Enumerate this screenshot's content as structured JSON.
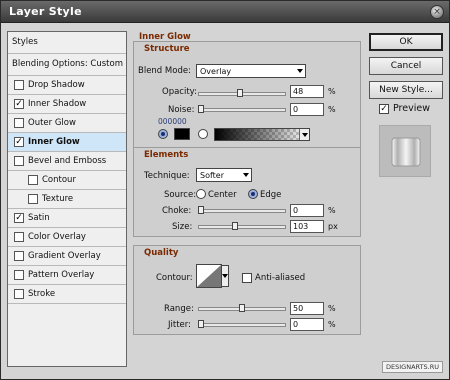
{
  "window": {
    "title": "Layer Style"
  },
  "sidebar": {
    "styles_label": "Styles",
    "blending_label": "Blending Options: Custom",
    "items": [
      {
        "label": "Drop Shadow",
        "checked": false
      },
      {
        "label": "Inner Shadow",
        "checked": true
      },
      {
        "label": "Outer Glow",
        "checked": false
      },
      {
        "label": "Inner Glow",
        "checked": true,
        "selected": true
      },
      {
        "label": "Bevel and Emboss",
        "checked": false
      },
      {
        "label": "Contour",
        "checked": false,
        "sub": true
      },
      {
        "label": "Texture",
        "checked": false,
        "sub": true
      },
      {
        "label": "Satin",
        "checked": true
      },
      {
        "label": "Color Overlay",
        "checked": false
      },
      {
        "label": "Gradient Overlay",
        "checked": false
      },
      {
        "label": "Pattern Overlay",
        "checked": false
      },
      {
        "label": "Stroke",
        "checked": false
      }
    ]
  },
  "panel": {
    "title": "Inner Glow",
    "structure": {
      "heading": "Structure",
      "blend_mode_label": "Blend Mode:",
      "blend_mode_value": "Overlay",
      "opacity_label": "Opacity:",
      "opacity_value": "48",
      "opacity_unit": "%",
      "noise_label": "Noise:",
      "noise_value": "0",
      "noise_unit": "%",
      "color_hex": "000000"
    },
    "elements": {
      "heading": "Elements",
      "technique_label": "Technique:",
      "technique_value": "Softer",
      "source_label": "Source:",
      "source_center": "Center",
      "source_edge": "Edge",
      "choke_label": "Choke:",
      "choke_value": "0",
      "choke_unit": "%",
      "size_label": "Size:",
      "size_value": "103",
      "size_unit": "px"
    },
    "quality": {
      "heading": "Quality",
      "contour_label": "Contour:",
      "antialiased_label": "Anti-aliased",
      "range_label": "Range:",
      "range_value": "50",
      "range_unit": "%",
      "jitter_label": "Jitter:",
      "jitter_value": "0",
      "jitter_unit": "%"
    }
  },
  "buttons": {
    "ok": "OK",
    "cancel": "Cancel",
    "new_style": "New Style...",
    "preview_label": "Preview"
  },
  "footer": {
    "credit": "DESIGNARTS.RU"
  }
}
